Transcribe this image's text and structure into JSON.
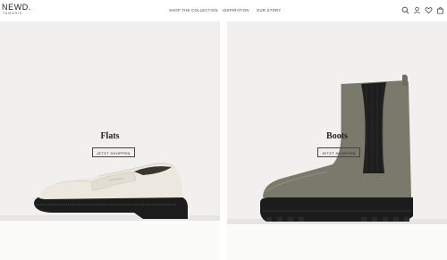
{
  "header": {
    "logo_main": "NEWD.",
    "logo_sub": "TAMARIS",
    "nav": [
      "SHOP THE COLLECTION",
      "INSPIRATION",
      "OUR STORY"
    ],
    "icons": [
      "search-icon",
      "account-icon",
      "wishlist-heart-icon",
      "cart-bag-icon"
    ]
  },
  "panels": [
    {
      "title": "Flats",
      "cta": "JETZT SHOPPEN"
    },
    {
      "title": "Boots",
      "cta": "JETZT SHOPPEN"
    }
  ],
  "colors": {
    "panel_bg": "#f1f0ee",
    "loafer": "#ece8df",
    "boot_olive": "#7a7a6c",
    "sole": "#1c1c1c"
  }
}
